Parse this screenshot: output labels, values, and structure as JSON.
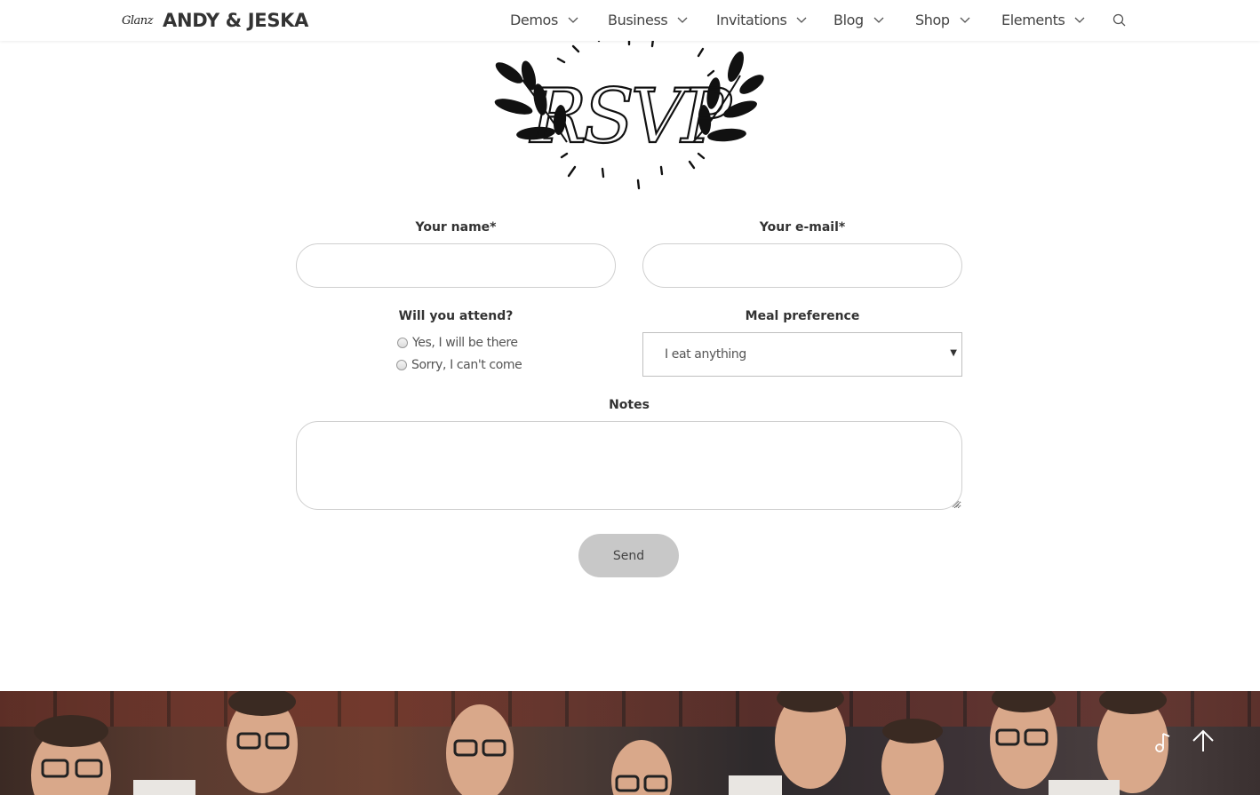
{
  "header": {
    "logo_script": "Glanz",
    "logo_title": "ANDY & JESKA",
    "nav": [
      {
        "label": "Demos"
      },
      {
        "label": "Business"
      },
      {
        "label": "Invitations"
      },
      {
        "label": "Blog"
      },
      {
        "label": "Shop"
      },
      {
        "label": "Elements"
      }
    ]
  },
  "emblem": {
    "text": "RSVP"
  },
  "form": {
    "name_label": "Your name*",
    "email_label": "Your e-mail*",
    "attend_label": "Will you attend?",
    "attend_options": [
      "Yes, I will be there",
      "Sorry, I can't come"
    ],
    "meal_label": "Meal preference",
    "meal_selected": "I eat anything",
    "notes_label": "Notes",
    "send_label": "Send"
  },
  "colors": {
    "text": "#333333",
    "border": "#cfcfcf",
    "button": "#c8c8c8"
  },
  "icons": {
    "search": "search-icon",
    "chevron": "chevron-down-icon",
    "music": "music-note-icon",
    "to_top": "arrow-up-icon"
  }
}
